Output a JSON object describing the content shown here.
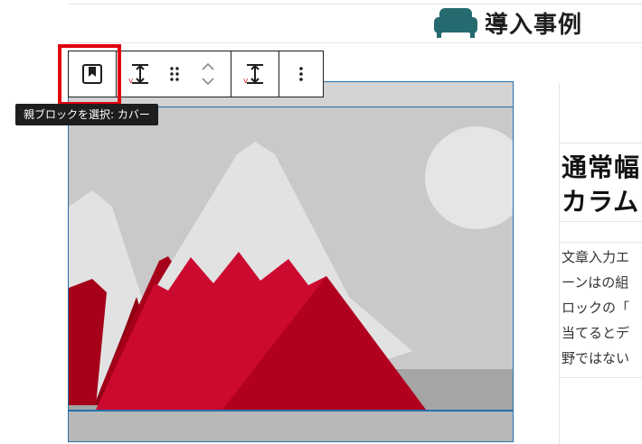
{
  "section_heading": {
    "text": "導入事例",
    "icon": "sofa-icon",
    "icon_color": "#256a6f"
  },
  "toolbar": {
    "select_parent_icon": "cover-block-icon",
    "align_icon": "vertical-align-icon",
    "drag_icon": "drag-handle-icon",
    "move_icon": "move-up-down-icon",
    "options_icon": "more-vertical-icon"
  },
  "tooltip": {
    "text": "親ブロックを選択: カバー"
  },
  "highlight_color": "#e1000f",
  "column": {
    "heading_lines": [
      "通常幅",
      "カラム"
    ],
    "paragraph_lines": [
      "文章入力エ",
      "ーンはの組",
      "ロックの「",
      "当てるとデ",
      "野ではない"
    ]
  }
}
